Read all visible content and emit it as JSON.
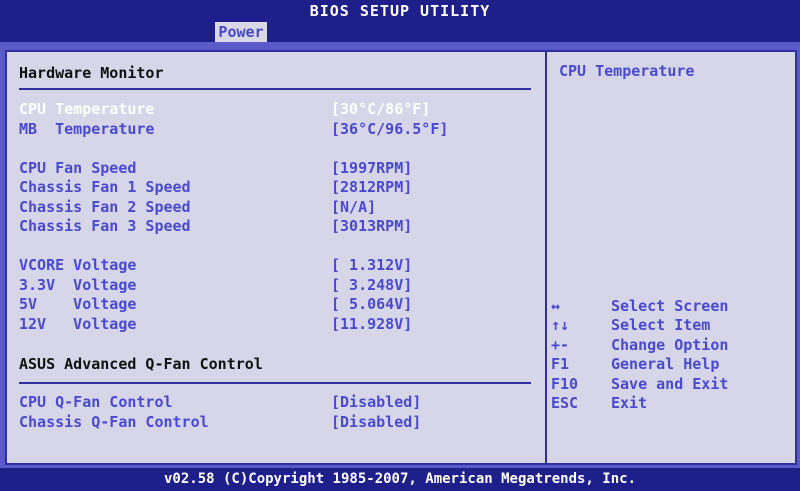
{
  "title": "BIOS SETUP UTILITY",
  "menu": {
    "active_tab": "Power"
  },
  "main": {
    "section_title": "Hardware Monitor",
    "readings": [
      {
        "label": "CPU Temperature",
        "value": "[30°C/86°F]",
        "selected": true
      },
      {
        "label": "MB  Temperature",
        "value": "[36°C/96.5°F]"
      },
      {
        "label": "CPU Fan Speed",
        "value": "[1997RPM]"
      },
      {
        "label": "Chassis Fan 1 Speed",
        "value": "[2812RPM]"
      },
      {
        "label": "Chassis Fan 2 Speed",
        "value": "[N/A]"
      },
      {
        "label": "Chassis Fan 3 Speed",
        "value": "[3013RPM]"
      },
      {
        "label": "VCORE Voltage",
        "value": "[ 1.312V]"
      },
      {
        "label": "3.3V  Voltage",
        "value": "[ 3.248V]"
      },
      {
        "label": "5V    Voltage",
        "value": "[ 5.064V]"
      },
      {
        "label": "12V   Voltage",
        "value": "[11.928V]"
      }
    ],
    "qfan_title": "ASUS Advanced Q-Fan Control",
    "qfan_items": [
      {
        "label": "CPU Q-Fan Control",
        "value": "[Disabled]"
      },
      {
        "label": "Chassis Q-Fan Control",
        "value": "[Disabled]"
      }
    ]
  },
  "help": {
    "title": "CPU Temperature",
    "keys": [
      {
        "key": "↔",
        "desc": "Select Screen"
      },
      {
        "key": "↑↓",
        "desc": "Select Item"
      },
      {
        "key": "+-",
        "desc": "Change Option"
      },
      {
        "key": "F1",
        "desc": "General Help"
      },
      {
        "key": "F10",
        "desc": "Save and Exit"
      },
      {
        "key": "ESC",
        "desc": "Exit"
      }
    ]
  },
  "footer": "v02.58 (C)Copyright 1985-2007, American Megatrends, Inc."
}
